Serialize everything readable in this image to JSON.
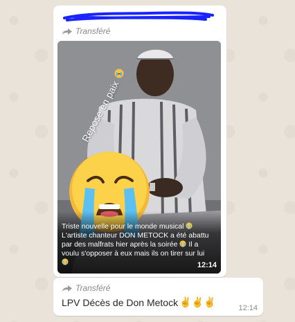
{
  "colors": {
    "chat_background": "#e9e3da",
    "bubble": "#ffffff",
    "sender_scribble": "#1a24ff",
    "secondary_text": "#8a8a8a"
  },
  "message_media": {
    "forwarded_label": "Transféré",
    "image_overlay_text": "Repose en paix",
    "caption_lines": [
      "Triste nouvelle pour le monde musical",
      "L'artiste chanteur DON METOCK a été abattu",
      "par des malfrats hier après la soirée",
      "Il a",
      "voulu s'opposer à eux mais ils on tirer sur lui"
    ],
    "time": "12:14"
  },
  "message_text": {
    "forwarded_label": "Transféré",
    "text": "LPV Décès de Don Metock",
    "emoji": "✌️✌️✌️",
    "time": "12:14"
  },
  "icons": [
    "forward-arrow-icon",
    "crying-face-emoji",
    "loudly-crying-face-emoji",
    "victory-hand-emoji"
  ]
}
